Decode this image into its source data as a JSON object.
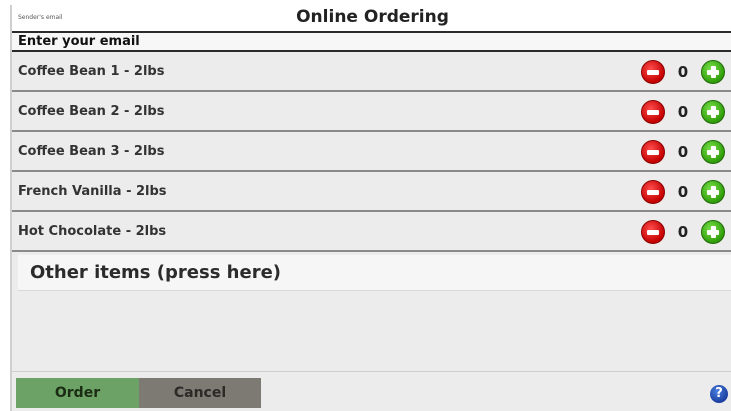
{
  "header": {
    "sender_label": "Sender's email",
    "title": "Online Ordering"
  },
  "email_field": {
    "placeholder": "Enter your email",
    "value": ""
  },
  "items": [
    {
      "label": "Coffee Bean 1 - 2lbs",
      "quantity": "0"
    },
    {
      "label": "Coffee Bean 2 - 2lbs",
      "quantity": "0"
    },
    {
      "label": "Coffee Bean 3 - 2lbs",
      "quantity": "0"
    },
    {
      "label": "French Vanilla - 2lbs",
      "quantity": "0"
    },
    {
      "label": "Hot Chocolate - 2lbs",
      "quantity": "0"
    }
  ],
  "other_items_label": "Other items (press here)",
  "footer": {
    "order_label": "Order",
    "cancel_label": "Cancel",
    "help_symbol": "?"
  },
  "icons": {
    "decrement": "minus-circle-icon",
    "increment": "plus-circle-icon",
    "help": "help-icon"
  },
  "colors": {
    "decrement_red": "#d10000",
    "increment_green": "#3fae12",
    "order_green": "#6da266",
    "cancel_gray": "#7c7a73",
    "help_blue": "#1b3fa0"
  }
}
